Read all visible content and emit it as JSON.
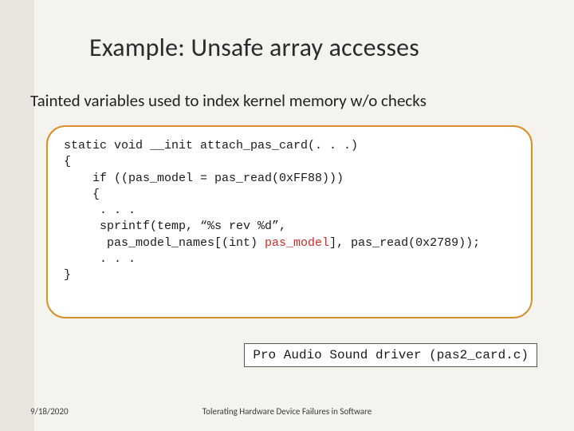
{
  "title": "Example: Unsafe array accesses",
  "subtitle": "Tainted variables used to index kernel memory w/o checks",
  "code": {
    "l1": "static void __init attach_pas_card(. . .)",
    "l2": "{",
    "l3": "    if ((pas_model = pas_read(0xFF88)))",
    "l4": "    {",
    "l5": "     . . .",
    "l6a": "     sprintf(temp, “%s rev %d”,",
    "l7a": "      pas_model_names[(int) ",
    "l7h": "pas_model",
    "l7b": "], pas_read(0x2789));",
    "l8": "     . . .",
    "l9": "}"
  },
  "caption": "Pro Audio Sound driver (pas2_card.c)",
  "footer": {
    "date": "9/18/2020",
    "presentation": "Tolerating Hardware Device Failures in Software"
  }
}
